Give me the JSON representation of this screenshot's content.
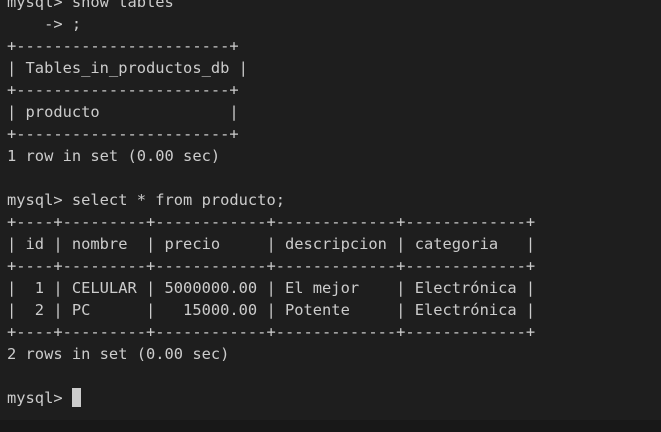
{
  "terminal": {
    "lines": [
      "mysql> show tables",
      "    -> ;",
      "+-----------------------+",
      "| Tables_in_productos_db |",
      "+-----------------------+",
      "| producto              |",
      "+-----------------------+",
      "1 row in set (0.00 sec)",
      "",
      "mysql> select * from producto;",
      "+----+---------+------------+-------------+-------------+",
      "| id | nombre  | precio     | descripcion | categoria   |",
      "+----+---------+------------+-------------+-------------+",
      "|  1 | CELULAR | 5000000.00 | El mejor    | Electrónica |",
      "|  2 | PC      |   15000.00 | Potente     | Electrónica |",
      "+----+---------+------------+-------------+-------------+",
      "2 rows in set (0.00 sec)",
      ""
    ],
    "prompt": "mysql> "
  }
}
